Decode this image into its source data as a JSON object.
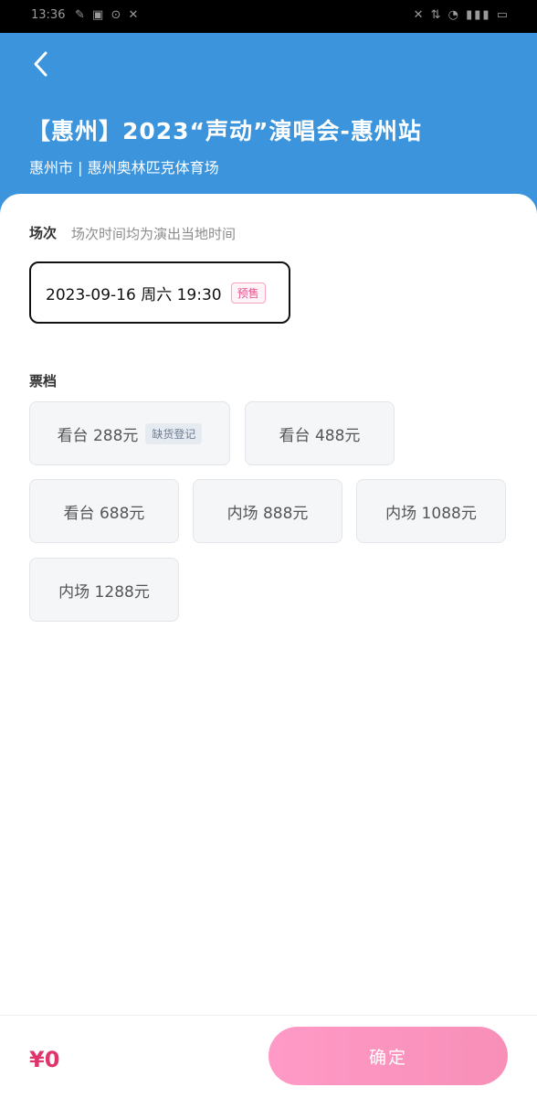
{
  "status_bar": {
    "time": "13:36",
    "left_icons": "✎ ▣ ⊙ ✕",
    "right_icons": "✕ ⇅ ◔ ▮▮▮ ▭"
  },
  "header": {
    "title": "【惠州】2023“声动”演唱会-惠州站",
    "subtitle": "惠州市 | 惠州奥林匹克体育场"
  },
  "session": {
    "label": "场次",
    "hint": "场次时间均为演出当地时间",
    "selected": "2023-09-16 周六 19:30",
    "tag": "预售"
  },
  "tickets": {
    "label": "票档",
    "items": [
      {
        "label": "看台 288元",
        "badge": "缺货登记"
      },
      {
        "label": "看台 488元"
      },
      {
        "label": "看台 688元"
      },
      {
        "label": "内场 888元"
      },
      {
        "label": "内场 1088元"
      },
      {
        "label": "内场 1288元"
      }
    ]
  },
  "footer": {
    "price": "¥0",
    "confirm": "确定"
  },
  "colors": {
    "header_bg": "#3b94dc",
    "accent": "#e0356b",
    "confirm_bg": "#ff9ac6"
  }
}
